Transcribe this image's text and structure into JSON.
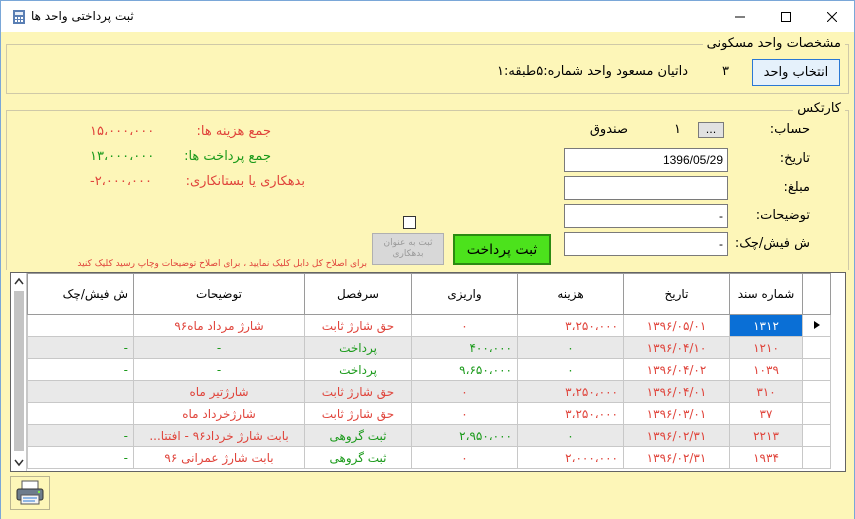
{
  "window": {
    "title": "ثبت پرداختی واحد ها"
  },
  "unit_section": {
    "legend": "مشخصات واحد مسکونی",
    "select_button": "انتخاب واحد",
    "unit_number": "۳",
    "unit_desc": "داتیان مسعود واحد شماره:۵طبقه:۱"
  },
  "cardex": {
    "legend": "کارتکس",
    "account_label": "حساب:",
    "account_button": "...",
    "account_code": "۱",
    "account_name": "صندوق",
    "date_label": "تاریخ:",
    "date_value": "1396/05/29",
    "amount_label": "مبلغ:",
    "amount_value": "",
    "desc_label": "توضیحات:",
    "desc_value": "-",
    "receipt_label": "ش فیش/چک:",
    "receipt_value": "-",
    "total_cost_label": "جمع هزینه ها:",
    "total_cost_value": "۱۵،۰۰۰،۰۰۰",
    "total_paid_label": "جمع پرداخت ها:",
    "total_paid_value": "۱۳،۰۰۰،۰۰۰",
    "balance_label": "بدهکاری یا بستانکاری:",
    "balance_value": "-۲،۰۰۰،۰۰۰",
    "submit_payment": "ثبت پرداخت",
    "submit_debt": "ثبت به عنوان بدهکاری",
    "hint": "برای اصلاح کل دابل کلیک نمایید ، برای اصلاح توضیحات وچاپ رسید کلیک کنید"
  },
  "table": {
    "columns": [
      "شماره سند",
      "تاریخ",
      "هزینه",
      "واریزی",
      "سرفصل",
      "توضیحات",
      "ش فیش/چک"
    ],
    "rows": [
      {
        "doc": "۱۳۱۲",
        "date": "۱۳۹۶/۰۵/۰۱",
        "cost": "۳،۲۵۰،۰۰۰",
        "paid": "۰",
        "head": "حق شارژ ثابت",
        "desc": "شارژ مرداد ماه۹۶",
        "receipt": ""
      },
      {
        "doc": "۱۲۱۰",
        "date": "۱۳۹۶/۰۴/۱۰",
        "cost": "۰",
        "paid": "۴۰۰،۰۰۰",
        "head": "پرداخت",
        "desc": "-",
        "receipt": "-"
      },
      {
        "doc": "۱۰۳۹",
        "date": "۱۳۹۶/۰۴/۰۲",
        "cost": "۰",
        "paid": "۹،۶۵۰،۰۰۰",
        "head": "پرداخت",
        "desc": "-",
        "receipt": "-"
      },
      {
        "doc": "۳۱۰",
        "date": "۱۳۹۶/۰۴/۰۱",
        "cost": "۳،۲۵۰،۰۰۰",
        "paid": "۰",
        "head": "حق شارژ ثابت",
        "desc": "شارژتیر ماه",
        "receipt": ""
      },
      {
        "doc": "۳۷",
        "date": "۱۳۹۶/۰۳/۰۱",
        "cost": "۳،۲۵۰،۰۰۰",
        "paid": "۰",
        "head": "حق شارژ ثابت",
        "desc": "شارژخرداد ماه",
        "receipt": ""
      },
      {
        "doc": "۲۲۱۳",
        "date": "۱۳۹۶/۰۲/۳۱",
        "cost": "۰",
        "paid": "۲،۹۵۰،۰۰۰",
        "head": "ثبت گروهی",
        "desc": "بابت شارژ خرداد۹۶ - افتتا...",
        "receipt": "-"
      },
      {
        "doc": "۱۹۳۴",
        "date": "۱۳۹۶/۰۲/۳۱",
        "cost": "۲،۰۰۰،۰۰۰",
        "paid": "۰",
        "head": "ثبت گروهی",
        "desc": "بابت شارژ عمرانی ۹۶",
        "receipt": "-"
      }
    ]
  },
  "colors": {
    "background": "#fdf6b8",
    "selection": "#0a6fd6",
    "red": "#e0443b",
    "green": "#1a9a1a",
    "submit_green": "#4ce21c"
  },
  "icons": {
    "app": "app-icon",
    "print": "printer-icon"
  }
}
